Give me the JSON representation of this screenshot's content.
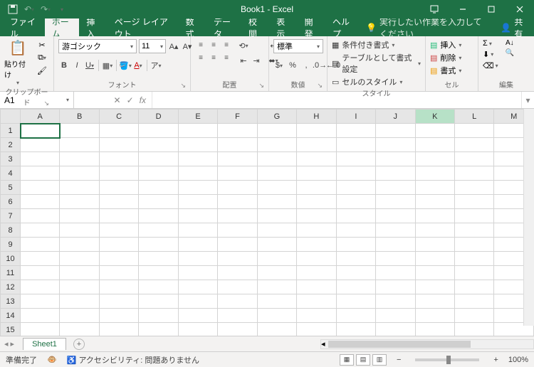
{
  "title": "Book1 - Excel",
  "tabs": {
    "file": "ファイル",
    "home": "ホーム",
    "insert": "挿入",
    "pagelayout": "ページ レイアウト",
    "formulas": "数式",
    "data": "データ",
    "review": "校閲",
    "view": "表示",
    "dev": "開発",
    "help": "ヘルプ"
  },
  "tellme": "実行したい作業を入力してください",
  "share": "共有",
  "ribbon": {
    "clipboard": {
      "paste": "貼り付け",
      "label": "クリップボード"
    },
    "font": {
      "name": "游ゴシック",
      "size": "11",
      "label": "フォント"
    },
    "alignment": {
      "label": "配置"
    },
    "number": {
      "format": "標準",
      "label": "数値"
    },
    "styles": {
      "cond": "条件付き書式",
      "tablefmt": "テーブルとして書式設定",
      "cellstyle": "セルのスタイル",
      "label": "スタイル"
    },
    "cells": {
      "insert": "挿入",
      "delete": "削除",
      "format": "書式",
      "label": "セル"
    },
    "editing": {
      "label": "編集"
    }
  },
  "namebox": "A1",
  "columns": [
    "A",
    "B",
    "C",
    "D",
    "E",
    "F",
    "G",
    "H",
    "I",
    "J",
    "K",
    "L",
    "M"
  ],
  "highlight_col": 10,
  "rows": [
    "1",
    "2",
    "3",
    "4",
    "5",
    "6",
    "7",
    "8",
    "9",
    "10",
    "11",
    "12",
    "13",
    "14",
    "15"
  ],
  "active_cell": {
    "row": 0,
    "col": 0
  },
  "sheet_tab": "Sheet1",
  "status": {
    "ready": "準備完了",
    "scroll": "",
    "access": "アクセシビリティ: 問題ありません",
    "zoom": "100%"
  }
}
